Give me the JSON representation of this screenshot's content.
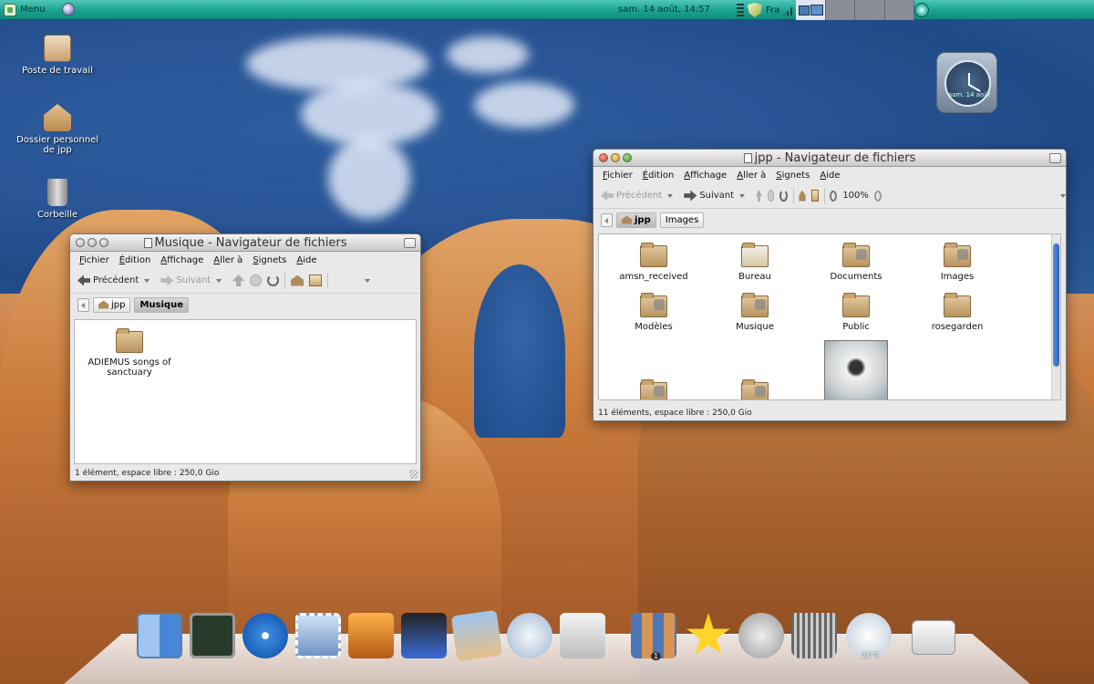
{
  "panel": {
    "menu_label": "Menu",
    "datetime": "sam. 14 août, 14:57",
    "keyboard": "Fra"
  },
  "desktop": {
    "icons": [
      {
        "label": "Poste de travail"
      },
      {
        "label": "Dossier personnel de jpp"
      },
      {
        "label": "Corbeille"
      }
    ],
    "clock_widget_date": "sam. 14 août"
  },
  "menu_items": [
    "Fichier",
    "Édition",
    "Affichage",
    "Aller à",
    "Signets",
    "Aide"
  ],
  "window_music": {
    "title": "Musique - Navigateur de fichiers",
    "toolbar": {
      "back": "Précédent",
      "forward": "Suivant"
    },
    "breadcrumbs": [
      "jpp",
      "Musique"
    ],
    "files": [
      {
        "label": "ADIEMUS songs of sanctuary"
      }
    ],
    "status": "1 élément, espace libre : 250,0 Gio"
  },
  "window_home": {
    "title": "jpp - Navigateur de fichiers",
    "toolbar": {
      "back": "Précédent",
      "forward": "Suivant",
      "zoom": "100%"
    },
    "breadcrumbs": [
      "jpp",
      "Images"
    ],
    "files": [
      {
        "label": "amsn_received"
      },
      {
        "label": "Bureau"
      },
      {
        "label": "Documents"
      },
      {
        "label": "Images"
      },
      {
        "label": "Modèles"
      },
      {
        "label": "Musique"
      },
      {
        "label": "Public"
      },
      {
        "label": "rosegarden"
      }
    ],
    "status": "11 éléments, espace libre : 250,0 Gio"
  },
  "dock": {
    "items": [
      {
        "icon": "finder-icon"
      },
      {
        "icon": "activity-monitor-icon"
      },
      {
        "icon": "safari-icon"
      },
      {
        "icon": "stamp-bird-icon"
      },
      {
        "icon": "photo-booth-icon"
      },
      {
        "icon": "imovie-icon"
      },
      {
        "icon": "iphoto-icon"
      },
      {
        "icon": "mail-icon"
      },
      {
        "icon": "toaster-icon"
      },
      {
        "icon": "spaces-icon"
      },
      {
        "icon": "favorites-star-icon"
      },
      {
        "icon": "at-mail-icon"
      },
      {
        "icon": "trash-icon"
      },
      {
        "icon": "weather-icon"
      },
      {
        "icon": "switch-icon"
      }
    ],
    "spaces_badge": "1",
    "weather_temp": "21°C"
  }
}
